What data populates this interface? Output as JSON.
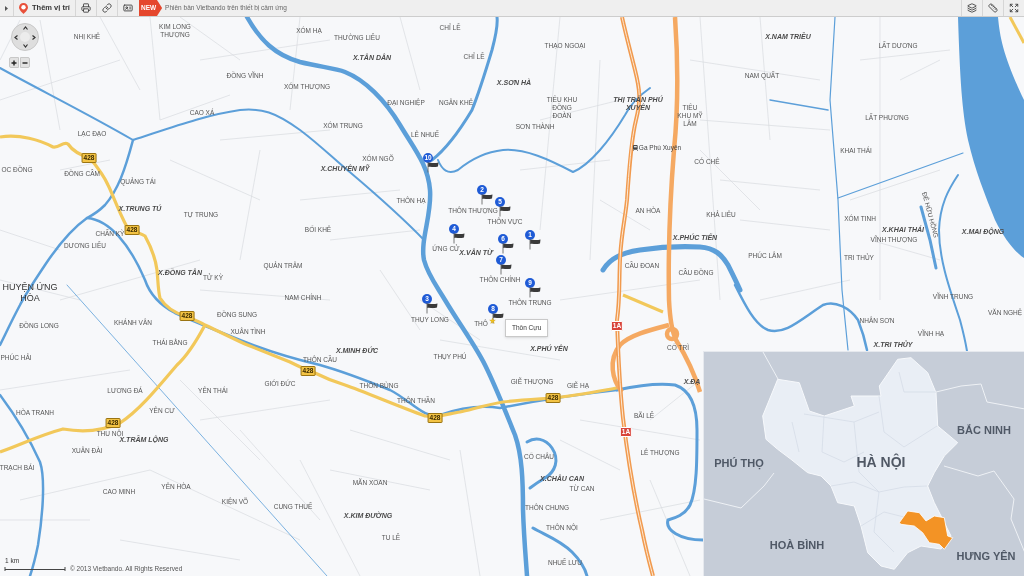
{
  "toolbar": {
    "add_location": "Thêm vị trí",
    "new_badge": "NEW",
    "promo": "Phiên bản Vietbando trên thiết bị cảm ứng"
  },
  "map": {
    "labels": [
      {
        "kind": "village",
        "text": "NHỊ KHÊ"
      },
      {
        "kind": "village",
        "text": "KIM LONG THƯỢNG"
      },
      {
        "kind": "village",
        "text": "XÓM HẠ"
      },
      {
        "kind": "village",
        "text": "THƯỜNG LIỄU"
      },
      {
        "kind": "village",
        "text": "CHỈ LỄ"
      },
      {
        "kind": "commune",
        "text": "X.NAM TRIỀU"
      },
      {
        "kind": "village",
        "text": "THẠO NGOẠI"
      },
      {
        "kind": "village",
        "text": "LẤT DƯƠNG"
      },
      {
        "kind": "commune",
        "text": "X.TÂN DÂN"
      },
      {
        "kind": "village",
        "text": "CHỈ LỄ"
      },
      {
        "kind": "village",
        "text": "ĐỒNG VĨNH"
      },
      {
        "kind": "village",
        "text": "NAM QUẤT"
      },
      {
        "kind": "village",
        "text": "XÓM THƯỢNG"
      },
      {
        "kind": "commune",
        "text": "X.SƠN HÀ"
      },
      {
        "kind": "village",
        "text": "CAO XÁ"
      },
      {
        "kind": "village",
        "text": "ĐẠI NGHIỆP"
      },
      {
        "kind": "village",
        "text": "NGÂN KHÊ"
      },
      {
        "kind": "village",
        "text": "TIỂU KHU ĐỒNG ĐOÀN"
      },
      {
        "kind": "town",
        "text": "THỊ TRẤN PHÚ XUYÊN"
      },
      {
        "kind": "village",
        "text": "TIỂU KHU MỸ LÂM"
      },
      {
        "kind": "village",
        "text": "LẤT PHƯƠNG"
      },
      {
        "kind": "village",
        "text": "XÓM TRUNG"
      },
      {
        "kind": "village",
        "text": "SƠN THÀNH"
      },
      {
        "kind": "village",
        "text": "LẠC ĐẠO"
      },
      {
        "kind": "village",
        "text": "LÊ NHUẾ"
      },
      {
        "kind": "station",
        "text": "Ga Phú Xuyên"
      },
      {
        "kind": "village",
        "text": "KHAI THÁI"
      },
      {
        "kind": "village",
        "text": "XÓM NGÕ"
      },
      {
        "kind": "village",
        "text": "CÓ CHÊ"
      },
      {
        "kind": "village",
        "text": "OC ĐỒNG"
      },
      {
        "kind": "village",
        "text": "ĐỒNG CẦM"
      },
      {
        "kind": "commune",
        "text": "X.CHUYÊN MỸ"
      },
      {
        "kind": "village",
        "text": "QUẢNG TÁI"
      },
      {
        "kind": "commune",
        "text": "X.TRUNG TÚ"
      },
      {
        "kind": "village",
        "text": "TỰ TRUNG"
      },
      {
        "kind": "village",
        "text": "THÔN HẠ"
      },
      {
        "kind": "village",
        "text": "THÔN THƯỢNG"
      },
      {
        "kind": "village",
        "text": "THÔN VỰC"
      },
      {
        "kind": "village",
        "text": "AN HÒA"
      },
      {
        "kind": "village",
        "text": "KHẢ LIÊU"
      },
      {
        "kind": "village",
        "text": "XÓM TINH"
      },
      {
        "kind": "village",
        "text": "CHẤN KỲ"
      },
      {
        "kind": "village",
        "text": "BỐI KHÊ"
      },
      {
        "kind": "commune",
        "text": "X.KHAI THÁI"
      },
      {
        "kind": "dike",
        "text": "ĐÊ HỮU HỒNG"
      },
      {
        "kind": "commune",
        "text": "X.MAI ĐỘNG"
      },
      {
        "kind": "village",
        "text": "DƯƠNG LIỄU"
      },
      {
        "kind": "village",
        "text": "ỨNG CỬ"
      },
      {
        "kind": "commune",
        "text": "X.PHÚC TIẾN"
      },
      {
        "kind": "village",
        "text": "VĨNH THƯỢNG"
      },
      {
        "kind": "commune",
        "text": "X.VÂN TỪ"
      },
      {
        "kind": "village",
        "text": "PHÚC LÂM"
      },
      {
        "kind": "village",
        "text": "TRI THỦY"
      },
      {
        "kind": "village",
        "text": "QUẢN TRÂM"
      },
      {
        "kind": "village",
        "text": "CẦU ĐOAN"
      },
      {
        "kind": "commune",
        "text": "X.ĐỒNG TÂN"
      },
      {
        "kind": "village",
        "text": "TỬ KỲ"
      },
      {
        "kind": "village",
        "text": "THÔN CHÍNH"
      },
      {
        "kind": "village",
        "text": "CẦU ĐỒNG"
      },
      {
        "kind": "district",
        "text": "HUYỆN ỨNG HÒA"
      },
      {
        "kind": "village",
        "text": "NAM CHÍNH"
      },
      {
        "kind": "village",
        "text": "THÔN TRUNG"
      },
      {
        "kind": "village",
        "text": "VĨNH TRUNG"
      },
      {
        "kind": "village",
        "text": "ĐỒNG SUNG"
      },
      {
        "kind": "village",
        "text": "ĐỒNG LONG"
      },
      {
        "kind": "village",
        "text": "KHÁNH VÂN"
      },
      {
        "kind": "village",
        "text": "THỤY LONG"
      },
      {
        "kind": "village",
        "text": "THÔ"
      },
      {
        "kind": "village",
        "text": "NHÂN SƠN"
      },
      {
        "kind": "village",
        "text": "VĂN NGHỆ"
      },
      {
        "kind": "village",
        "text": "XUÂN TÌNH"
      },
      {
        "kind": "village",
        "text": "VĨNH HẠ"
      },
      {
        "kind": "village",
        "text": "THÁI BẰNG"
      },
      {
        "kind": "commune",
        "text": "X.MINH ĐỨC"
      },
      {
        "kind": "commune",
        "text": "X.PHÚ YÊN"
      },
      {
        "kind": "village",
        "text": "CỔ TRÌ"
      },
      {
        "kind": "commune",
        "text": "X.TRI THỦY"
      },
      {
        "kind": "village",
        "text": "PHÚC HẢI"
      },
      {
        "kind": "village",
        "text": "THÔN CẦU"
      },
      {
        "kind": "village",
        "text": "THỤY PHÚ"
      },
      {
        "kind": "village",
        "text": "LƯƠNG ĐÁ"
      },
      {
        "kind": "village",
        "text": "YÊN THÁI"
      },
      {
        "kind": "village",
        "text": "GIỚI ĐỨC"
      },
      {
        "kind": "village",
        "text": "THÔN BÙNG"
      },
      {
        "kind": "village",
        "text": "GIẼ THƯỢNG"
      },
      {
        "kind": "village",
        "text": "GIẼ HẠ"
      },
      {
        "kind": "commune",
        "text": "X.ĐẠ"
      },
      {
        "kind": "village",
        "text": "THÔN THẦN"
      },
      {
        "kind": "village",
        "text": "HÒA TRANH"
      },
      {
        "kind": "village",
        "text": "YÊN CƯ"
      },
      {
        "kind": "village",
        "text": "BÃI LỄ"
      },
      {
        "kind": "village",
        "text": "THU NỘI"
      },
      {
        "kind": "commune",
        "text": "X.TRẦM LỘNG"
      },
      {
        "kind": "village",
        "text": "XUÂN ĐÀI"
      },
      {
        "kind": "village",
        "text": "CỔ CHÂU"
      },
      {
        "kind": "village",
        "text": "LÊ THƯỢNG"
      },
      {
        "kind": "village",
        "text": "TRẠCH BÁI"
      },
      {
        "kind": "village",
        "text": "CAO MINH"
      },
      {
        "kind": "village",
        "text": "YÊN HÒA"
      },
      {
        "kind": "village",
        "text": "MÃN XOAN"
      },
      {
        "kind": "commune",
        "text": "X.CHÂU CAN"
      },
      {
        "kind": "village",
        "text": "TỪ CAN"
      },
      {
        "kind": "village",
        "text": "KIỆN VÕ"
      },
      {
        "kind": "village",
        "text": "CUNG THUẾ"
      },
      {
        "kind": "village",
        "text": "THÔN CHUNG"
      },
      {
        "kind": "commune",
        "text": "X.KIM ĐƯỜNG"
      },
      {
        "kind": "village",
        "text": "THÔN NỘI"
      },
      {
        "kind": "village",
        "text": "TU LỄ"
      },
      {
        "kind": "village",
        "text": "NHUẾ LƯU"
      }
    ],
    "road_shields": [
      {
        "kind": "provincial",
        "text": "428"
      },
      {
        "kind": "provincial",
        "text": "428"
      },
      {
        "kind": "provincial",
        "text": "428"
      },
      {
        "kind": "national",
        "text": "1A"
      },
      {
        "kind": "provincial",
        "text": "428"
      },
      {
        "kind": "provincial",
        "text": "428"
      },
      {
        "kind": "provincial",
        "text": "428"
      },
      {
        "kind": "provincial",
        "text": "428"
      },
      {
        "kind": "national",
        "text": "1A"
      }
    ],
    "markers": [
      {
        "number": "10",
        "selected": false
      },
      {
        "number": "2",
        "selected": false
      },
      {
        "number": "5",
        "selected": false
      },
      {
        "number": "4",
        "selected": false
      },
      {
        "number": "6",
        "selected": false
      },
      {
        "number": "1",
        "selected": false
      },
      {
        "number": "7",
        "selected": false
      },
      {
        "number": "9",
        "selected": false
      },
      {
        "number": "3",
        "selected": false
      },
      {
        "number": "8",
        "selected": true
      }
    ],
    "tooltip": "Thôn Cựu",
    "scale": "1 km",
    "copyright": "© 2013 Vietbando. All Rights Reserved"
  },
  "inset": {
    "labels": [
      {
        "kind": "province",
        "text": "BẮC NINH"
      },
      {
        "kind": "province",
        "text": "PHÚ THỌ"
      },
      {
        "kind": "city",
        "text": "HÀ NỘI"
      },
      {
        "kind": "province",
        "text": "HOÀ BÌNH"
      },
      {
        "kind": "province",
        "text": "HƯNG YÊN"
      }
    ]
  }
}
